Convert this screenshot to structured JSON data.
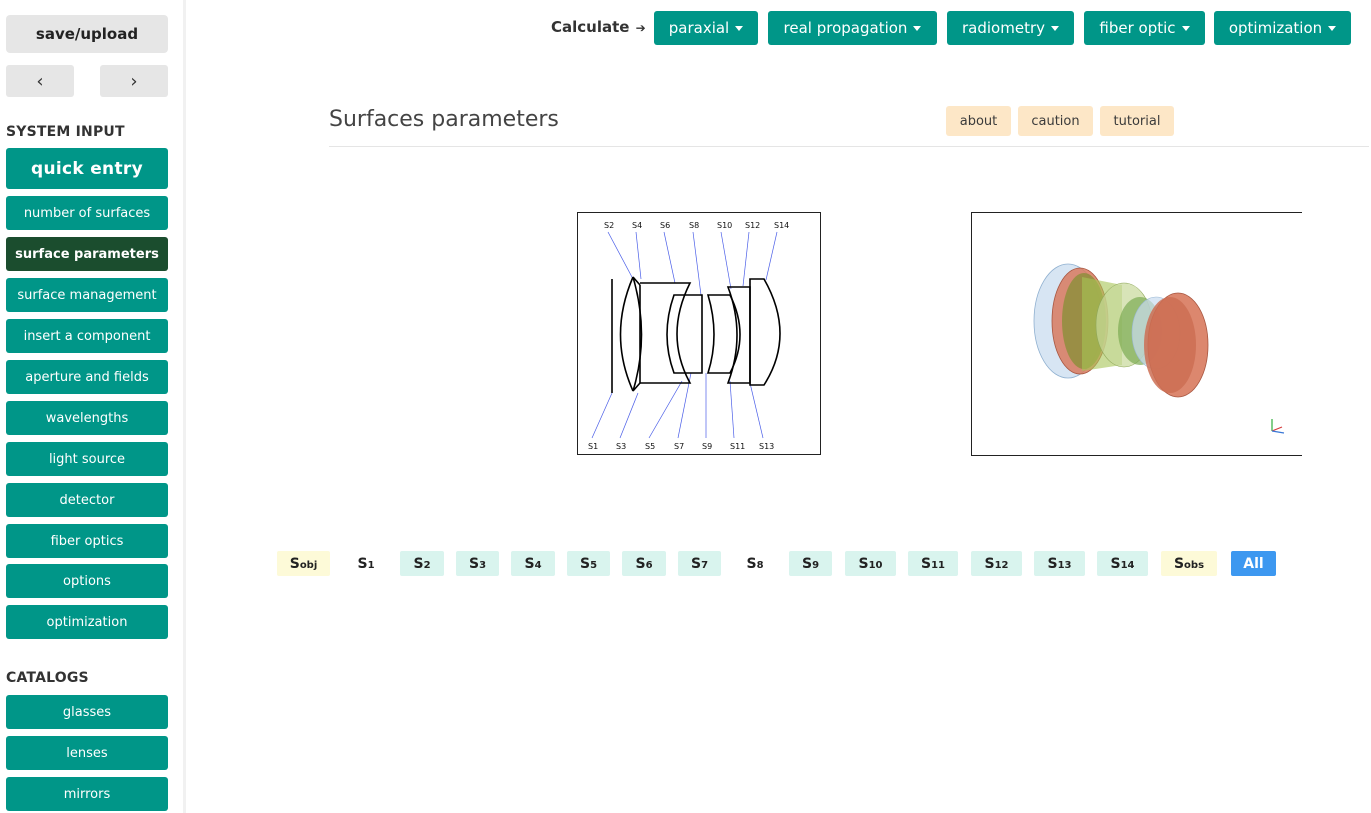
{
  "sidebar": {
    "save_label": "save/upload",
    "prev_label": "‹",
    "next_label": "›",
    "system_input_heading": "SYSTEM INPUT",
    "quick_entry": "quick entry",
    "items": [
      {
        "label": "number of surfaces"
      },
      {
        "label": "surface parameters",
        "active": true
      },
      {
        "label": "surface management"
      },
      {
        "label": "insert a component"
      },
      {
        "label": "aperture and fields"
      },
      {
        "label": "wavelengths"
      },
      {
        "label": "light source"
      },
      {
        "label": "detector"
      },
      {
        "label": "fiber optics"
      },
      {
        "label": "options"
      },
      {
        "label": "optimization"
      }
    ],
    "catalogs_heading": "CATALOGS",
    "catalogs": [
      {
        "label": "glasses"
      },
      {
        "label": "lenses"
      },
      {
        "label": "mirrors"
      }
    ]
  },
  "topbar": {
    "calculate_label": "Calculate",
    "menus": [
      {
        "label": "paraxial"
      },
      {
        "label": "real propagation"
      },
      {
        "label": "radiometry"
      },
      {
        "label": "fiber optic"
      },
      {
        "label": "optimization"
      }
    ]
  },
  "main": {
    "title": "Surfaces parameters",
    "info_buttons": [
      {
        "label": "about"
      },
      {
        "label": "caution"
      },
      {
        "label": "tutorial"
      }
    ],
    "diagram_labels_top": [
      "S2",
      "S4",
      "S6",
      "S8",
      "S10",
      "S12",
      "S14"
    ],
    "diagram_labels_bottom": [
      "S1",
      "S3",
      "S5",
      "S7",
      "S9",
      "S11",
      "S13"
    ],
    "surfaces": [
      {
        "base": "S",
        "sub": "obj",
        "style": "yellow"
      },
      {
        "base": "S",
        "sub": "1",
        "style": "white"
      },
      {
        "base": "S",
        "sub": "2",
        "style": "cyan"
      },
      {
        "base": "S",
        "sub": "3",
        "style": "cyan"
      },
      {
        "base": "S",
        "sub": "4",
        "style": "cyan"
      },
      {
        "base": "S",
        "sub": "5",
        "style": "cyan"
      },
      {
        "base": "S",
        "sub": "6",
        "style": "cyan"
      },
      {
        "base": "S",
        "sub": "7",
        "style": "cyan"
      },
      {
        "base": "S",
        "sub": "8",
        "style": "white"
      },
      {
        "base": "S",
        "sub": "9",
        "style": "cyan"
      },
      {
        "base": "S",
        "sub": "10",
        "style": "cyan"
      },
      {
        "base": "S",
        "sub": "11",
        "style": "cyan"
      },
      {
        "base": "S",
        "sub": "12",
        "style": "cyan"
      },
      {
        "base": "S",
        "sub": "13",
        "style": "cyan"
      },
      {
        "base": "S",
        "sub": "14",
        "style": "cyan"
      },
      {
        "base": "S",
        "sub": "obs",
        "style": "yellow"
      }
    ],
    "all_label": "All"
  },
  "colors": {
    "teal": "#009688",
    "active_dark_green": "#1b4d2e",
    "info_peach": "#fde7c7",
    "all_blue": "#3d98f0"
  }
}
